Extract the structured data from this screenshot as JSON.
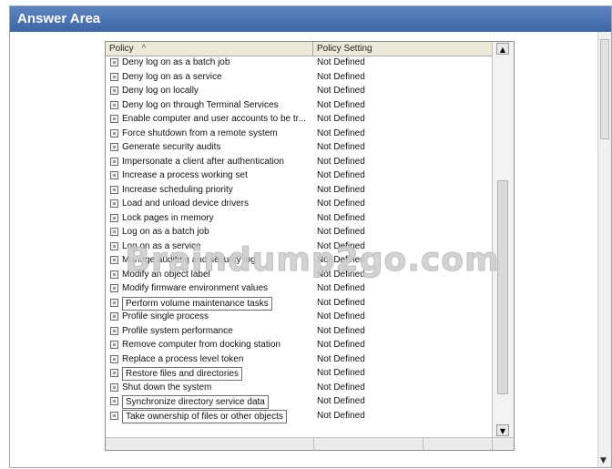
{
  "window": {
    "title": "Answer Area"
  },
  "list": {
    "columns": [
      "Policy",
      "Policy Setting"
    ],
    "sort_indicator": "^",
    "scroll_up": "▲",
    "scroll_down": "▼",
    "rows": [
      {
        "policy": "Deny log on as a batch job",
        "setting": "Not Defined",
        "boxed": false
      },
      {
        "policy": "Deny log on as a service",
        "setting": "Not Defined",
        "boxed": false
      },
      {
        "policy": "Deny log on locally",
        "setting": "Not Defined",
        "boxed": false
      },
      {
        "policy": "Deny log on through Terminal Services",
        "setting": "Not Defined",
        "boxed": false
      },
      {
        "policy": "Enable computer and user accounts to be tr...",
        "setting": "Not Defined",
        "boxed": false
      },
      {
        "policy": "Force shutdown from a remote system",
        "setting": "Not Defined",
        "boxed": false
      },
      {
        "policy": "Generate security audits",
        "setting": "Not Defined",
        "boxed": false
      },
      {
        "policy": "Impersonate a client after authentication",
        "setting": "Not Defined",
        "boxed": false
      },
      {
        "policy": "Increase a process working set",
        "setting": "Not Defined",
        "boxed": false
      },
      {
        "policy": "Increase scheduling priority",
        "setting": "Not Defined",
        "boxed": false
      },
      {
        "policy": "Load and unload device drivers",
        "setting": "Not Defined",
        "boxed": false
      },
      {
        "policy": "Lock pages in memory",
        "setting": "Not Defined",
        "boxed": false
      },
      {
        "policy": "Log on as a batch job",
        "setting": "Not Defined",
        "boxed": false
      },
      {
        "policy": "Log on as a service",
        "setting": "Not Defined",
        "boxed": false
      },
      {
        "policy": "Manage auditing and security log",
        "setting": "Not Defined",
        "boxed": false
      },
      {
        "policy": "Modify an object label",
        "setting": "Not Defined",
        "boxed": false
      },
      {
        "policy": "Modify firmware environment values",
        "setting": "Not Defined",
        "boxed": false
      },
      {
        "policy": "Perform volume maintenance tasks",
        "setting": "Not Defined",
        "boxed": true
      },
      {
        "policy": "Profile single process",
        "setting": "Not Defined",
        "boxed": false
      },
      {
        "policy": "Profile system performance",
        "setting": "Not Defined",
        "boxed": false
      },
      {
        "policy": "Remove computer from docking station",
        "setting": "Not Defined",
        "boxed": false
      },
      {
        "policy": "Replace a process level token",
        "setting": "Not Defined",
        "boxed": false
      },
      {
        "policy": "Restore files and directories",
        "setting": "Not Defined",
        "boxed": true
      },
      {
        "policy": "Shut down the system",
        "setting": "Not Defined",
        "boxed": false
      },
      {
        "policy": "Synchronize directory service data",
        "setting": "Not Defined",
        "boxed": true
      },
      {
        "policy": "Take ownership of files or other objects",
        "setting": "Not Defined",
        "boxed": true
      }
    ]
  },
  "watermark": {
    "text": "Braindump2go.com"
  },
  "colors": {
    "title_bar": "#4a72b0",
    "title_text": "#ffffff",
    "header_bg": "#ece9d8"
  }
}
